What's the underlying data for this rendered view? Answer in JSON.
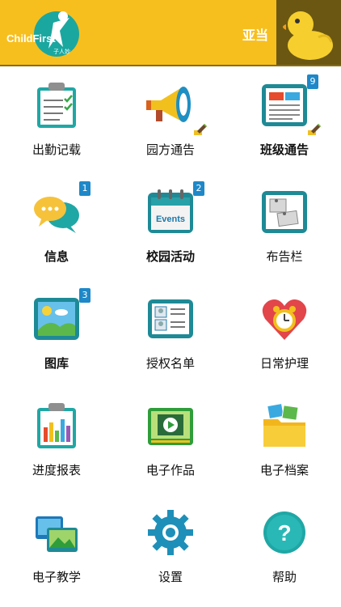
{
  "header": {
    "logo_text": "ChildFirst",
    "logo_subtext": "子人妙",
    "user_name": "亚当",
    "brand_color": "#f7bf1e",
    "avatar_icon": "duck-icon"
  },
  "menu": [
    {
      "label": "出勤记载",
      "bold": false,
      "icon": "clipboard-icon"
    },
    {
      "label": "园方通告",
      "bold": false,
      "icon": "megaphone-icon"
    },
    {
      "label": "班级通告",
      "bold": true,
      "icon": "newspaper-icon",
      "badge": "9"
    },
    {
      "label": "信息",
      "bold": true,
      "icon": "chat-bubbles-icon",
      "badge": "1"
    },
    {
      "label": "校园活动",
      "bold": true,
      "icon": "calendar-icon",
      "badge": "2",
      "icon_text": "Events"
    },
    {
      "label": "布告栏",
      "bold": false,
      "icon": "bulletin-board-icon"
    },
    {
      "label": "图库",
      "bold": true,
      "icon": "photo-gallery-icon",
      "badge": "3"
    },
    {
      "label": "授权名单",
      "bold": false,
      "icon": "id-card-icon"
    },
    {
      "label": "日常护理",
      "bold": false,
      "icon": "heart-clock-icon"
    },
    {
      "label": "进度报表",
      "bold": false,
      "icon": "bar-chart-clipboard-icon"
    },
    {
      "label": "电子作品",
      "bold": false,
      "icon": "video-player-icon"
    },
    {
      "label": "电子档案",
      "bold": false,
      "icon": "folder-icon"
    },
    {
      "label": "电子教学",
      "bold": false,
      "icon": "slides-icon"
    },
    {
      "label": "设置",
      "bold": false,
      "icon": "gear-icon"
    },
    {
      "label": "帮助",
      "bold": false,
      "icon": "help-icon"
    }
  ]
}
